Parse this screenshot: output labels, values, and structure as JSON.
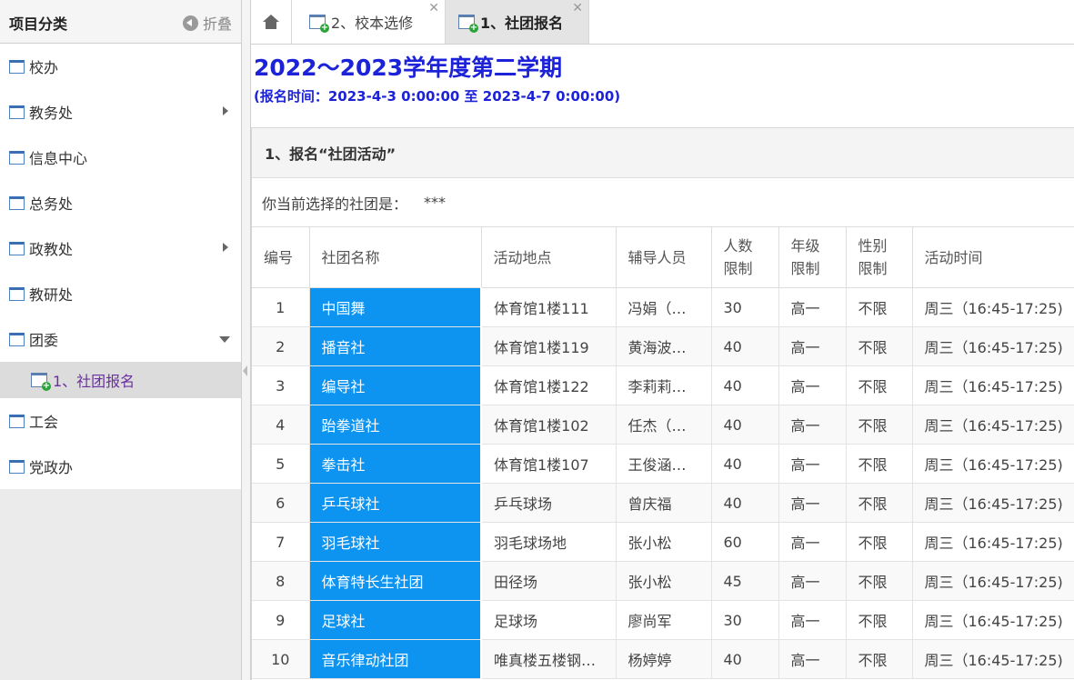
{
  "sidebar": {
    "title": "项目分类",
    "collapse_label": "折叠",
    "items": [
      {
        "label": "校办",
        "arrow": "none"
      },
      {
        "label": "教务处",
        "arrow": "right"
      },
      {
        "label": "信息中心",
        "arrow": "none"
      },
      {
        "label": "总务处",
        "arrow": "none"
      },
      {
        "label": "政教处",
        "arrow": "right"
      },
      {
        "label": "教研处",
        "arrow": "none"
      },
      {
        "label": "团委",
        "arrow": "down"
      },
      {
        "label": "工会",
        "arrow": "none"
      },
      {
        "label": "党政办",
        "arrow": "none"
      }
    ],
    "sub_item": "1、社团报名"
  },
  "tabs": [
    {
      "label": "2、校本选修",
      "active": false
    },
    {
      "label": "1、社团报名",
      "active": true
    }
  ],
  "content": {
    "term_title": "2022～2023学年度第二学期",
    "reg_time": "(报名时间：2023-4-3 0:00:00 至 2023-4-7 0:00:00)",
    "panel_title": "1、报名“社团活动”",
    "selected_label": "你当前选择的社团是：",
    "selected_value": "***",
    "columns": [
      "编号",
      "社团名称",
      "活动地点",
      "辅导人员",
      "人数\n限制",
      "年级\n限制",
      "性别\n限制",
      "活动时间"
    ],
    "rows": [
      [
        "1",
        "中国舞",
        "体育馆1楼111",
        "冯娟（…",
        "30",
        "高一",
        "不限",
        "周三（16:45-17:25)"
      ],
      [
        "2",
        "播音社",
        "体育馆1楼119",
        "黄海波…",
        "40",
        "高一",
        "不限",
        "周三（16:45-17:25)"
      ],
      [
        "3",
        "编导社",
        "体育馆1楼122",
        "李莉莉…",
        "40",
        "高一",
        "不限",
        "周三（16:45-17:25)"
      ],
      [
        "4",
        "跆拳道社",
        "体育馆1楼102",
        "任杰（…",
        "40",
        "高一",
        "不限",
        "周三（16:45-17:25)"
      ],
      [
        "5",
        "拳击社",
        "体育馆1楼107",
        "王俊涵…",
        "40",
        "高一",
        "不限",
        "周三（16:45-17:25)"
      ],
      [
        "6",
        "乒乓球社",
        "乒乓球场",
        "曾庆福",
        "40",
        "高一",
        "不限",
        "周三（16:45-17:25)"
      ],
      [
        "7",
        "羽毛球社",
        "羽毛球场地",
        "张小松",
        "60",
        "高一",
        "不限",
        "周三（16:45-17:25)"
      ],
      [
        "8",
        "体育特长生社团",
        "田径场",
        "张小松",
        "45",
        "高一",
        "不限",
        "周三（16:45-17:25)"
      ],
      [
        "9",
        "足球社",
        "足球场",
        "廖尚军",
        "30",
        "高一",
        "不限",
        "周三（16:45-17:25)"
      ],
      [
        "10",
        "音乐律动社团",
        "唯真楼五楼钢…",
        "杨婷婷",
        "40",
        "高一",
        "不限",
        "周三（16:45-17:25)"
      ]
    ]
  },
  "colors": {
    "title_blue": "#1c22d8",
    "club_cell_blue": "#0d93f0",
    "sub_item_text": "#6a2fa0"
  }
}
